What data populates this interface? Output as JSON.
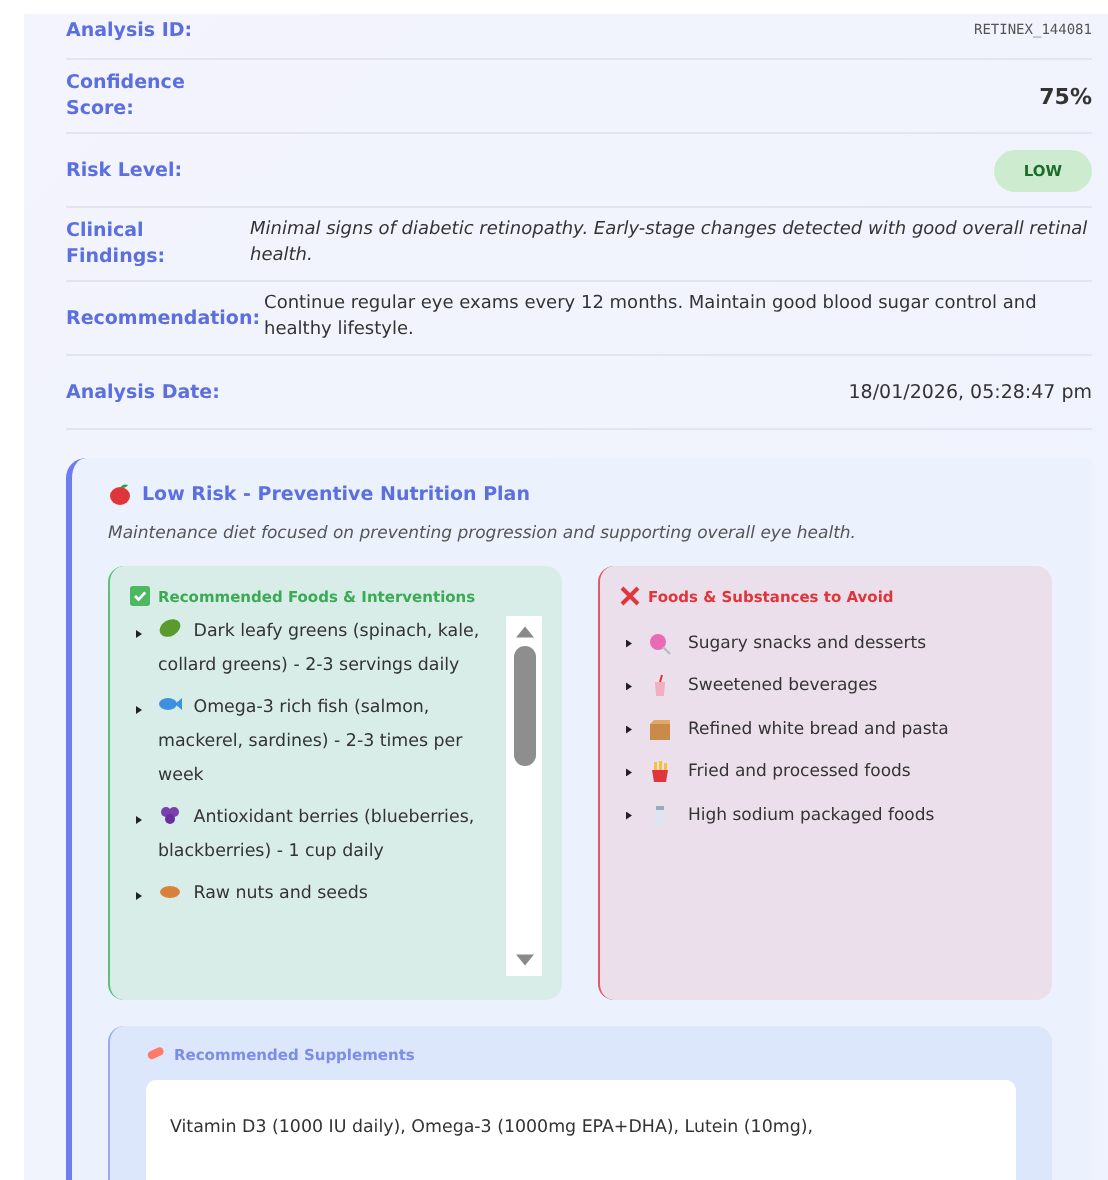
{
  "analysis": {
    "rows": [
      {
        "kind": "mono",
        "label": "Analysis ID:",
        "value": "RETINEX_144081"
      },
      {
        "kind": "score",
        "label": "Confidence Score:",
        "value": "75%"
      },
      {
        "kind": "badge",
        "label": "Risk Level:",
        "value": "LOW"
      },
      {
        "kind": "italic",
        "label": "Clinical Findings:",
        "value": "Minimal signs of diabetic retinopathy. Early-stage changes detected with good overall retinal health."
      },
      {
        "kind": "text",
        "label": "Recommendation:",
        "value": "Continue regular eye exams every 12 months. Maintain good blood sugar control and healthy lifestyle."
      },
      {
        "kind": "date",
        "label": "Analysis Date:",
        "value": "18/01/2026, 05:28:47 pm"
      }
    ]
  },
  "plan": {
    "title": "Low Risk - Preventive Nutrition Plan",
    "description": "Maintenance diet focused on preventing progression and supporting overall eye health.",
    "recommended": {
      "title": "Recommended Foods & Interventions",
      "items": [
        "Dark leafy greens (spinach, kale, collard greens) - 2-3 servings daily",
        "Omega-3 rich fish (salmon, mackerel, sardines) - 2-3 times per week",
        "Antioxidant berries (blueberries, blackberries) - 1 cup daily",
        "Raw nuts and seeds"
      ]
    },
    "avoid": {
      "title": "Foods & Substances to Avoid",
      "items": [
        "Sugary snacks and desserts",
        "Sweetened beverages",
        "Refined white bread and pasta",
        "Fried and processed foods",
        "High sodium packaged foods"
      ]
    },
    "supplements": {
      "title": "Recommended Supplements",
      "text": "Vitamin D3 (1000 IU daily), Omega-3 (1000mg EPA+DHA), Lutein (10mg),"
    }
  }
}
